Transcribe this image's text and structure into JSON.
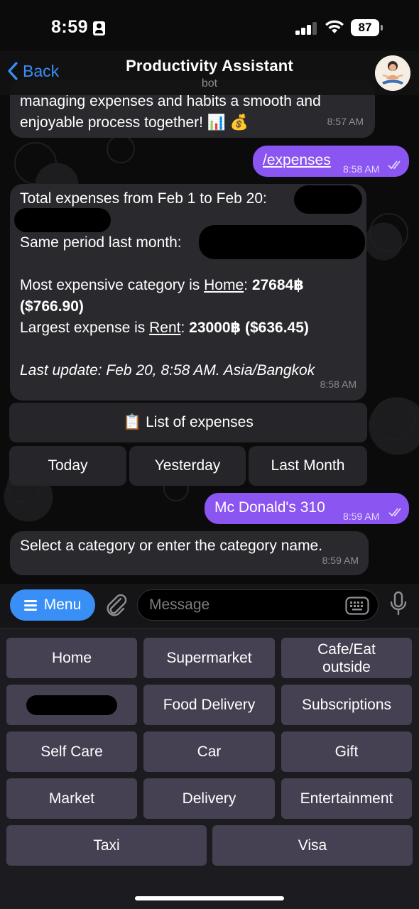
{
  "status_bar": {
    "time": "8:59",
    "battery": "87"
  },
  "header": {
    "back_label": "Back",
    "title": "Productivity Assistant",
    "subtitle": "bot"
  },
  "messages": {
    "m1": {
      "line1": "managing expenses and habits a smooth and",
      "line2": "enjoyable process together! 📊 💰",
      "time": "8:57 AM"
    },
    "m2": {
      "text": "/expenses",
      "time": "8:58 AM"
    },
    "m3": {
      "total_label": "Total expenses from Feb 1 to Feb 20:",
      "same_period_label": "Same period last month:",
      "most_prefix": "Most expensive category is ",
      "most_category": "Home",
      "most_colon": ": ",
      "most_amount": "27684฿",
      "most_usd": "($766.90)",
      "largest_prefix": "Largest expense is ",
      "largest_item": "Rent",
      "largest_colon": ": ",
      "largest_amount": "23000฿ ($636.45)",
      "last_update": "Last update: Feb 20, 8:58 AM. Asia/Bangkok",
      "time": "8:58 AM"
    },
    "m4": {
      "text": "Mc Donald's 310",
      "time": "8:59 AM"
    },
    "m5": {
      "text": "Select a category or enter the category name.",
      "time": "8:59 AM"
    }
  },
  "inline_keyboard": {
    "list_expenses": "📋 List of expenses",
    "today": "Today",
    "yesterday": "Yesterday",
    "last_month": "Last Month"
  },
  "input_bar": {
    "menu_label": "Menu",
    "placeholder": "Message"
  },
  "reply_keyboard": [
    "Home",
    "Supermarket",
    "Cafe/Eat outside",
    "",
    "Food Delivery",
    "Subscriptions",
    "Self Care",
    "Car",
    "Gift",
    "Market",
    "Delivery",
    "Entertainment",
    "Taxi",
    "Visa"
  ],
  "colors": {
    "accent": "#3a8ff7",
    "outgoing_bubble": "#8a55f0",
    "incoming_bubble": "#2a292e",
    "keyboard_button": "#454152"
  }
}
